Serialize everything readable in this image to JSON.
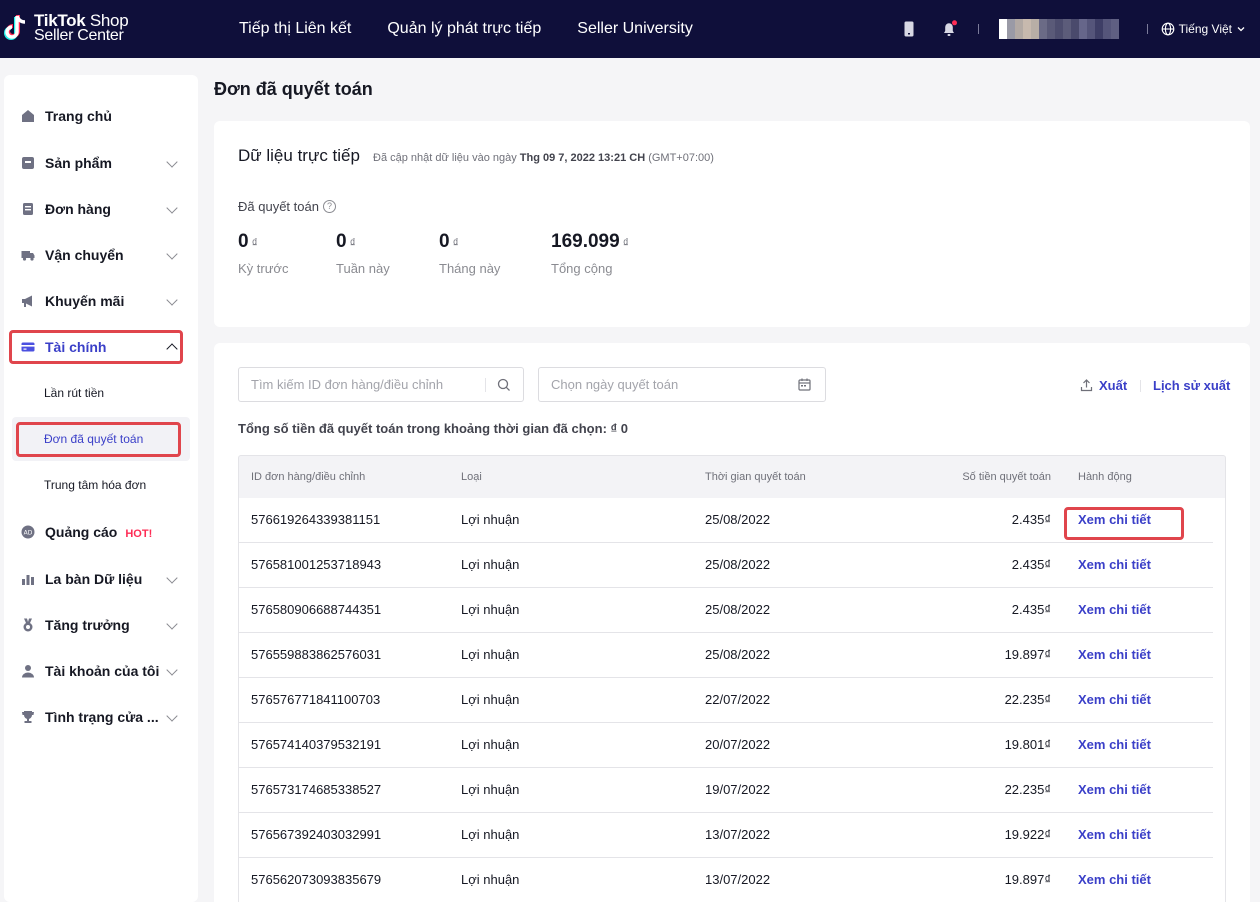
{
  "header": {
    "logo_line1_bold": "TikTok",
    "logo_line1_rest": " Shop",
    "logo_line2": "Seller Center",
    "nav": [
      "Tiếp thị Liên kết",
      "Quản lý phát trực tiếp",
      "Seller University"
    ],
    "language": "Tiếng Việt"
  },
  "sidebar": {
    "items": [
      {
        "label": "Trang chủ",
        "icon": "home-icon"
      },
      {
        "label": "Sản phẩm",
        "icon": "product-icon"
      },
      {
        "label": "Đơn hàng",
        "icon": "order-icon"
      },
      {
        "label": "Vận chuyển",
        "icon": "truck-icon"
      },
      {
        "label": "Khuyến mãi",
        "icon": "megaphone-icon"
      },
      {
        "label": "Tài chính",
        "icon": "card-icon"
      },
      {
        "label": "Quảng cáo",
        "icon": "ad-icon",
        "badge": "HOT!"
      },
      {
        "label": "La bàn Dữ liệu",
        "icon": "chart-icon"
      },
      {
        "label": "Tăng trưởng",
        "icon": "medal-icon"
      },
      {
        "label": "Tài khoản của tôi",
        "icon": "user-icon"
      },
      {
        "label": "Tình trạng cửa ...",
        "icon": "trophy-icon"
      }
    ],
    "finance_sub": [
      "Lần rút tiền",
      "Đơn đã quyết toán",
      "Trung tâm hóa đơn"
    ]
  },
  "page": {
    "title": "Đơn đã quyết toán"
  },
  "live": {
    "title": "Dữ liệu trực tiếp",
    "updated_prefix": "Đã cập nhật dữ liệu vào ngày ",
    "updated_time": "Thg 09 7, 2022 13:21 CH",
    "updated_tz": " (GMT+07:00)",
    "settled_label": "Đã quyết toán",
    "currency": "₫",
    "stats": [
      {
        "value": "0",
        "label": "Kỳ trước"
      },
      {
        "value": "0",
        "label": "Tuần này"
      },
      {
        "value": "0",
        "label": "Tháng này"
      },
      {
        "value": "169.099",
        "label": "Tổng cộng"
      }
    ]
  },
  "filters": {
    "search_placeholder": "Tìm kiếm ID đơn hàng/điều chỉnh",
    "date_placeholder": "Chọn ngày quyết toán",
    "export_label": "Xuất",
    "export_history_label": "Lịch sử xuất",
    "total_text": "Tổng số tiền đã quyết toán trong khoảng thời gian đã chọn: ₫ 0"
  },
  "table": {
    "columns": [
      "ID đơn hàng/điều chỉnh",
      "Loại",
      "Thời gian quyết toán",
      "Số tiền quyết toán",
      "Hành động"
    ],
    "rows": [
      {
        "id": "576619264339381151",
        "type": "Lợi nhuận",
        "date": "25/08/2022",
        "amount": "2.435₫",
        "action": "Xem chi tiết"
      },
      {
        "id": "576581001253718943",
        "type": "Lợi nhuận",
        "date": "25/08/2022",
        "amount": "2.435₫",
        "action": "Xem chi tiết"
      },
      {
        "id": "576580906688744351",
        "type": "Lợi nhuận",
        "date": "25/08/2022",
        "amount": "2.435₫",
        "action": "Xem chi tiết"
      },
      {
        "id": "576559883862576031",
        "type": "Lợi nhuận",
        "date": "25/08/2022",
        "amount": "19.897₫",
        "action": "Xem chi tiết"
      },
      {
        "id": "576576771841100703",
        "type": "Lợi nhuận",
        "date": "22/07/2022",
        "amount": "22.235₫",
        "action": "Xem chi tiết"
      },
      {
        "id": "576574140379532191",
        "type": "Lợi nhuận",
        "date": "20/07/2022",
        "amount": "19.801₫",
        "action": "Xem chi tiết"
      },
      {
        "id": "576573174685338527",
        "type": "Lợi nhuận",
        "date": "19/07/2022",
        "amount": "22.235₫",
        "action": "Xem chi tiết"
      },
      {
        "id": "576567392403032991",
        "type": "Lợi nhuận",
        "date": "13/07/2022",
        "amount": "19.922₫",
        "action": "Xem chi tiết"
      },
      {
        "id": "576562073093835679",
        "type": "Lợi nhuận",
        "date": "13/07/2022",
        "amount": "19.897₫",
        "action": "Xem chi tiết"
      }
    ]
  },
  "colors": {
    "topbar": "#0f0f3a",
    "link": "#3a3fc8",
    "highlight": "#e0454c",
    "hot": "#fe2c55"
  }
}
